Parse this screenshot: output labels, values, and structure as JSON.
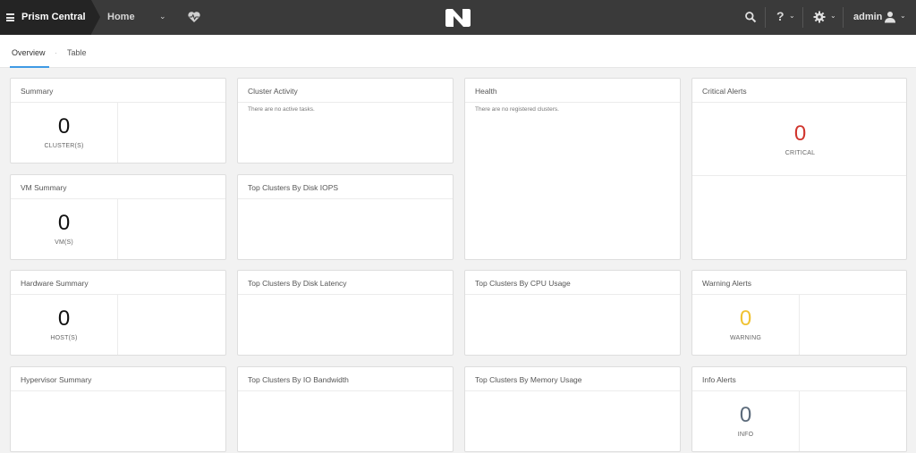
{
  "topbar": {
    "brand": "Prism Central",
    "home": "Home",
    "chevron": "⌄",
    "help": "?",
    "user": "admin",
    "colors": {
      "bar": "#3a3a3a",
      "brand_bg": "#242424"
    },
    "icons": [
      "menu-icon",
      "heart-icon",
      "nutanix-logo",
      "search-icon",
      "help-icon",
      "gear-icon",
      "user-icon"
    ]
  },
  "subnav": {
    "tabs": [
      "Overview",
      "Table"
    ],
    "active_color": "#3f9ae4"
  },
  "widgets": {
    "summary": {
      "title": "Summary",
      "value": "0",
      "label": "CLUSTER(S)"
    },
    "cluster_activity": {
      "title": "Cluster Activity",
      "message": "There are no active tasks."
    },
    "health": {
      "title": "Health",
      "message": "There are no registered clusters."
    },
    "critical_alerts": {
      "title": "Critical Alerts",
      "value": "0",
      "label": "CRITICAL",
      "color": "#d0352d"
    },
    "vm_summary": {
      "title": "VM Summary",
      "value": "0",
      "label": "VM(S)"
    },
    "top_disk_iops": {
      "title": "Top Clusters By Disk IOPS"
    },
    "hardware_summary": {
      "title": "Hardware Summary",
      "value": "0",
      "label": "HOST(S)"
    },
    "top_disk_latency": {
      "title": "Top Clusters By Disk Latency"
    },
    "top_cpu": {
      "title": "Top Clusters By CPU Usage"
    },
    "warning_alerts": {
      "title": "Warning Alerts",
      "value": "0",
      "label": "WARNING",
      "color": "#f0c232"
    },
    "hypervisor_summary": {
      "title": "Hypervisor Summary"
    },
    "top_io_bandwidth": {
      "title": "Top Clusters By IO Bandwidth"
    },
    "top_memory": {
      "title": "Top Clusters By Memory Usage"
    },
    "info_alerts": {
      "title": "Info Alerts",
      "value": "0",
      "label": "INFO",
      "color": "#5b6a7a"
    }
  }
}
